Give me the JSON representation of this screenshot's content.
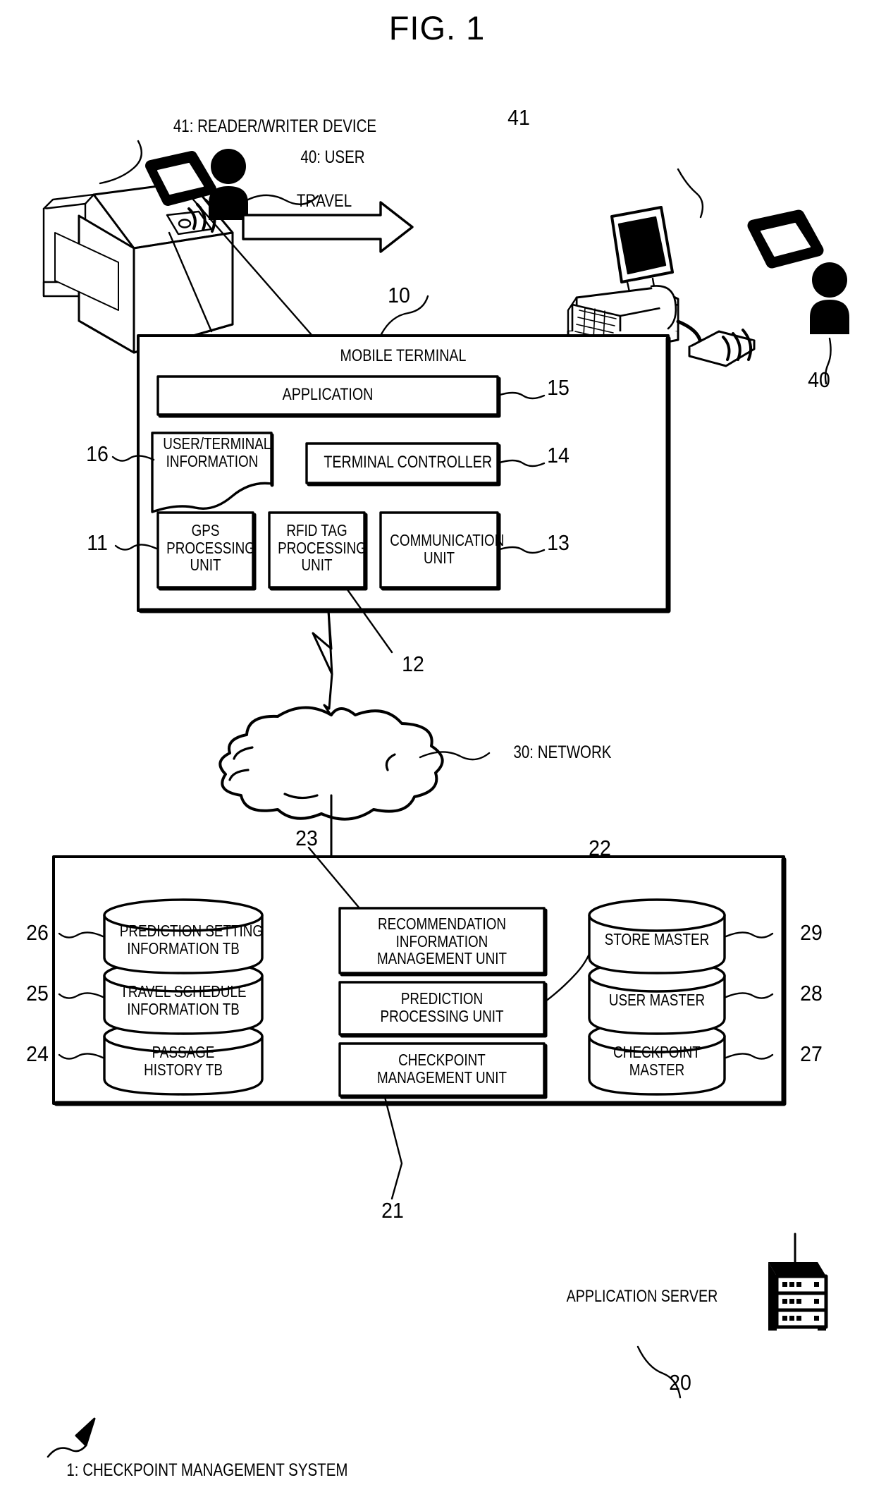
{
  "figure": {
    "title": "FIG. 1",
    "caption_number": "1",
    "caption_text": "1: CHECKPOINT MANAGEMENT SYSTEM"
  },
  "scene": {
    "travel_arrow_label": "TRAVEL",
    "left_station": {
      "reader_label": "41: READER/WRITER DEVICE",
      "user_label": "40: USER",
      "reader_ref": "41",
      "user_ref": "40"
    },
    "right_store": {
      "reader_ref": "41",
      "user_ref": "40"
    }
  },
  "mobile_terminal": {
    "ref": "10",
    "title": "MOBILE TERMINAL",
    "blocks": [
      {
        "ref": "15",
        "label": "APPLICATION"
      },
      {
        "ref": "16",
        "label": "USER/TERMINAL\nINFORMATION"
      },
      {
        "ref": "14",
        "label": "TERMINAL CONTROLLER"
      },
      {
        "ref": "11",
        "label": "GPS\nPROCESSING\nUNIT"
      },
      {
        "ref": "12",
        "label": "RFID TAG\nPROCESSING\nUNIT"
      },
      {
        "ref": "13",
        "label": "COMMUNICATION\nUNIT"
      }
    ]
  },
  "network": {
    "ref": "30",
    "label": "30: NETWORK"
  },
  "application_server": {
    "ref": "20",
    "title": "APPLICATION SERVER",
    "left_databases": [
      {
        "ref": "26",
        "label": "PREDICTION SETTING\nINFORMATION TB"
      },
      {
        "ref": "25",
        "label": "TRAVEL SCHEDULE\nINFORMATION TB"
      },
      {
        "ref": "24",
        "label": "PASSAGE\nHISTORY TB"
      }
    ],
    "units": [
      {
        "ref": "23",
        "label": "RECOMMENDATION\nINFORMATION\nMANAGEMENT UNIT"
      },
      {
        "ref": "22",
        "label": "PREDICTION\nPROCESSING UNIT"
      },
      {
        "ref": "21",
        "label": "CHECKPOINT\nMANAGEMENT UNIT"
      }
    ],
    "right_databases": [
      {
        "ref": "29",
        "label": "STORE MASTER"
      },
      {
        "ref": "28",
        "label": "USER MASTER"
      },
      {
        "ref": "27",
        "label": "CHECKPOINT\nMASTER"
      }
    ]
  },
  "colors": {
    "ink": "#000000",
    "paper": "#ffffff"
  }
}
